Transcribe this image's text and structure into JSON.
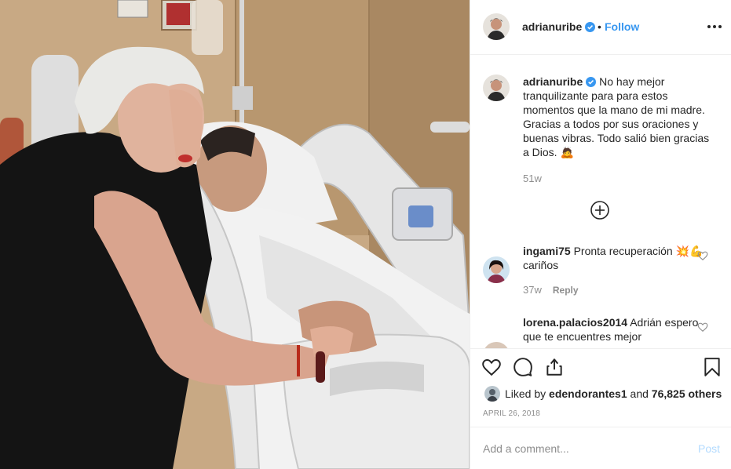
{
  "post": {
    "author": "adrianuribe",
    "follow_label": "Follow",
    "separator": "•",
    "caption": {
      "user": "adrianuribe",
      "text": "No hay mejor tranquilizante para para estos momentos que la mano de mi madre. Gracias a todos por sus oraciones y buenas vibras. Todo salió bien gracias a Dios. 🙇",
      "time": "51w"
    },
    "comments": [
      {
        "user": "ingami75",
        "text": "Pronta recuperación 💥💪 cariños",
        "time": "37w",
        "reply_label": "Reply"
      },
      {
        "user": "lorena.palacios2014",
        "text": "Adrián espero que te encuentres mejor"
      }
    ],
    "likes": {
      "prefix": "Liked by",
      "user": "edendorantes1",
      "joiner": "and",
      "count_text": "76,825 others"
    },
    "date": "APRIL 26, 2018",
    "comment_box": {
      "placeholder": "Add a comment...",
      "post_label": "Post"
    }
  },
  "colors": {
    "link": "#3897f0",
    "muted": "#8e8e8e",
    "text": "#262626",
    "post_disabled": "#b3dbff",
    "verified": "#3897f0",
    "border": "#efefef"
  },
  "icons": [
    "more-options-icon",
    "verified-badge-icon",
    "load-more-icon",
    "like-heart-icon",
    "comment-icon",
    "share-icon",
    "save-bookmark-icon",
    "comment-like-icon"
  ]
}
